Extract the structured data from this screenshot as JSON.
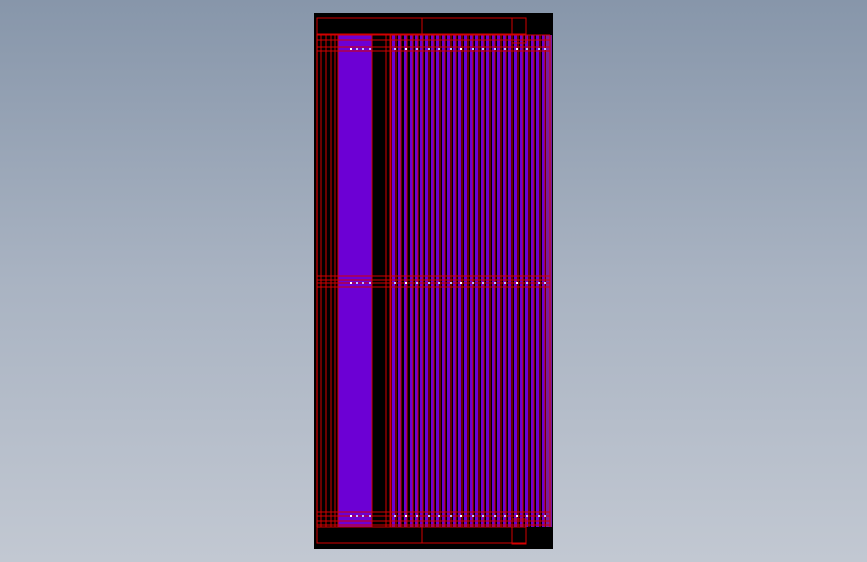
{
  "viewport": {
    "background_top": "#8796aa",
    "background_bottom": "#c2c8d2"
  },
  "drawing": {
    "sheet_color": "#000000",
    "outline_color": "#d40000",
    "fill_color": "#6c00d4",
    "side_fill_color": "#7a1a9e",
    "mark_color": "#b9b9ff",
    "mark_bright": "#ffffff"
  }
}
